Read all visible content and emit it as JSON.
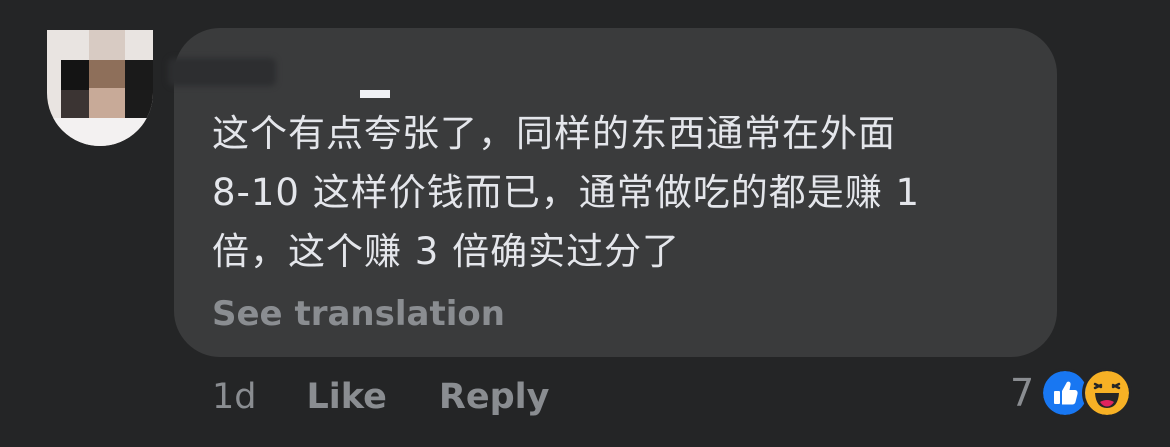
{
  "comment": {
    "text": "这个有点夸张了，同样的东西通常在外面\n 8-10 这样价钱而已，通常做吃的都是赚 1\n倍，这个赚 3 倍确实过分了",
    "see_translation": "See translation"
  },
  "actions": {
    "time": "1d",
    "like_label": "Like",
    "reply_label": "Reply"
  },
  "reactions": {
    "count": "7",
    "icons": [
      "like-reaction-icon",
      "haha-reaction-icon"
    ]
  },
  "colors": {
    "background": "#242526",
    "bubble": "#3a3b3c",
    "text": "#e4e6eb",
    "secondary": "#8a8d91",
    "like_blue": "#1877f2",
    "haha_yellow": "#f7b125"
  }
}
